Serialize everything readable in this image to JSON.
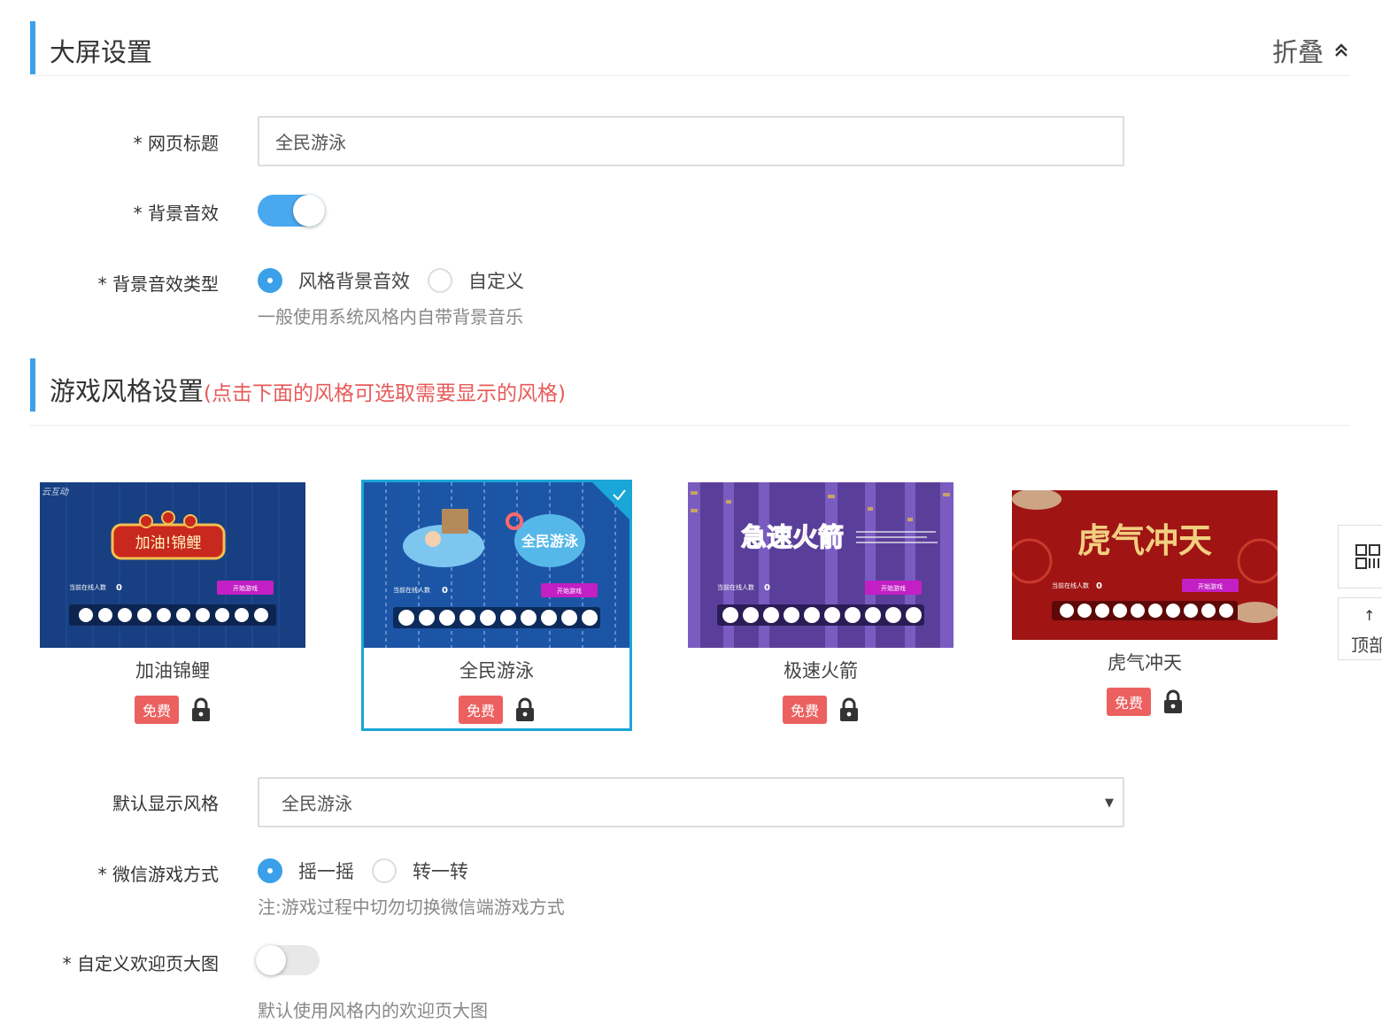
{
  "screen_section": {
    "title": "大屏设置",
    "collapse_label": "折叠"
  },
  "page_title_field": {
    "label": "* 网页标题",
    "value": "全民游泳"
  },
  "bg_sound": {
    "label": "* 背景音效",
    "enabled": true
  },
  "bg_sound_type": {
    "label": "* 背景音效类型",
    "options": [
      "风格背景音效",
      "自定义"
    ],
    "selected": "风格背景音效",
    "help": "一般使用系统风格内自带背景音乐"
  },
  "game_section": {
    "title": "游戏风格设置",
    "hint": "(点击下面的风格可选取需要显示的风格)"
  },
  "styles": [
    {
      "name": "加油锦鲤",
      "badge": "免费",
      "selected": false,
      "thumb": {
        "logo": "加油!锦鲤",
        "corner": "云互动",
        "online_label": "当前在线人数",
        "online_count": "0",
        "start_label": "开始游戏",
        "bg": "#163f85",
        "accent": "#c0392b"
      }
    },
    {
      "name": "全民游泳",
      "badge": "免费",
      "selected": true,
      "thumb": {
        "logo": "全民游泳",
        "corner": "",
        "online_label": "当前在线人数",
        "online_count": "0",
        "start_label": "开始游戏",
        "bg": "#1d56a8",
        "accent": "#3aa0e0"
      }
    },
    {
      "name": "极速火箭",
      "badge": "免费",
      "selected": false,
      "thumb": {
        "logo": "急速火箭",
        "corner": "",
        "online_label": "当前在线人数",
        "online_count": "0",
        "start_label": "开始游戏",
        "bg": "#5a3f9a",
        "accent": "#e03030"
      }
    },
    {
      "name": "虎气冲天",
      "badge": "免费",
      "selected": false,
      "thumb": {
        "logo": "虎气冲天",
        "corner": "",
        "online_label": "当前在线人数",
        "online_count": "0",
        "start_label": "开始游戏",
        "bg": "#a01515",
        "accent": "#f0c060"
      }
    }
  ],
  "default_style": {
    "label": "默认显示风格",
    "value": "全民游泳"
  },
  "wechat_mode": {
    "label": "* 微信游戏方式",
    "options": [
      "摇一摇",
      "转一转"
    ],
    "selected": "摇一摇",
    "help": "注:游戏过程中切勿切换微信端游戏方式"
  },
  "custom_welcome": {
    "label": "* 自定义欢迎页大图",
    "enabled": false,
    "help": "默认使用风格内的欢迎页大图"
  },
  "side": {
    "qr_icon": "qrcode-icon",
    "top_label": "顶部",
    "top_arrow": "↑"
  },
  "colors": {
    "accent": "#3ba0e9",
    "hint": "#e85a5a",
    "badge": "#ec6060",
    "selected_border": "#1ba6d8"
  }
}
